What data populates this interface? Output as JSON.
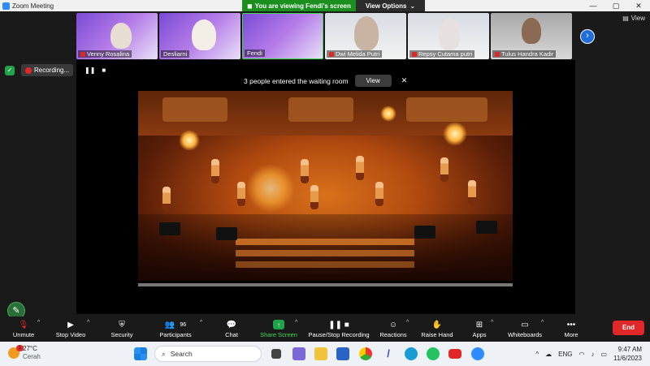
{
  "window": {
    "app_title": "Zoom Meeting",
    "controls": [
      "—",
      "▢",
      "✕"
    ]
  },
  "banner": {
    "viewing_text": "You are viewing Fendi's screen",
    "options_label": "View Options"
  },
  "view_button": {
    "label": "View"
  },
  "participants_strip": [
    {
      "name": "Venny Rosalina",
      "muted": true
    },
    {
      "name": "Desliarni",
      "muted": false
    },
    {
      "name": "Fendi",
      "muted": false
    },
    {
      "name": "Dwi Melida Putri",
      "muted": true
    },
    {
      "name": "Repsy Cutama putri",
      "muted": true
    },
    {
      "name": "Tulus Handra Kadir",
      "muted": true
    }
  ],
  "recording_indicator": {
    "label": "Recording..."
  },
  "waiting_room": {
    "message": "3 people entered the waiting room",
    "view_label": "View",
    "close": "✕"
  },
  "toolbar": {
    "unmute": "Unmute",
    "stop_video": "Stop Video",
    "security": "Security",
    "participants": "Participants",
    "participants_count": "96",
    "chat": "Chat",
    "share_screen": "Share Screen",
    "pause_stop_recording": "Pause/Stop Recording",
    "reactions": "Reactions",
    "raise_hand": "Raise Hand",
    "apps": "Apps",
    "whiteboards": "Whiteboards",
    "more": "More",
    "end": "End"
  },
  "taskbar": {
    "weather_temp": "27°C",
    "weather_desc": "Cerah",
    "weather_badge": "1",
    "search_placeholder": "Search",
    "language": "ENG",
    "time": "9:47 AM",
    "date": "11/6/2023"
  },
  "colors": {
    "accent_green": "#1a8f1e",
    "end_red": "#e02828",
    "zoom_blue": "#2d8cff"
  }
}
